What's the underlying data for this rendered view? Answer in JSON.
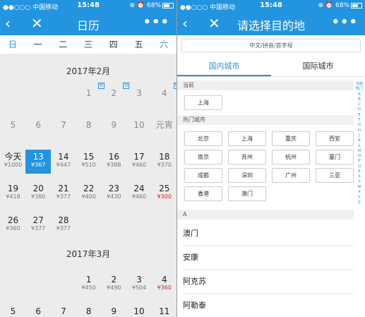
{
  "status": {
    "carrier": "●●○○○ 中国移动",
    "time": "15:48",
    "battery": "⊕ ⏰ 68%"
  },
  "calendar": {
    "title": "日历",
    "weekdays": [
      "日",
      "一",
      "二",
      "三",
      "四",
      "五",
      "六"
    ],
    "feb_title": "2017年2月",
    "mar_title": "2017年3月",
    "feb_rows": [
      [
        {
          "d": ""
        },
        {
          "d": ""
        },
        {
          "d": ""
        },
        {
          "d": "1",
          "past": true,
          "ban": "班"
        },
        {
          "d": "2",
          "past": true,
          "ban": "班"
        },
        {
          "d": "3",
          "past": true
        },
        {
          "d": "4",
          "past": true,
          "ban": "班"
        }
      ],
      [
        {
          "d": "5",
          "past": true
        },
        {
          "d": "6",
          "past": true
        },
        {
          "d": "7",
          "past": true
        },
        {
          "d": "8",
          "past": true
        },
        {
          "d": "9",
          "past": true
        },
        {
          "d": "10",
          "past": true
        },
        {
          "d": "元宵",
          "past": true
        }
      ],
      [
        {
          "d": "今天",
          "p": "¥1000"
        },
        {
          "d": "13",
          "p": "¥367",
          "sel": true
        },
        {
          "d": "14",
          "p": "¥447"
        },
        {
          "d": "15",
          "p": "¥510"
        },
        {
          "d": "16",
          "p": "¥388"
        },
        {
          "d": "17",
          "p": "¥460"
        },
        {
          "d": "18",
          "p": "¥370"
        }
      ],
      [
        {
          "d": "19",
          "p": "¥418"
        },
        {
          "d": "20",
          "p": "¥380"
        },
        {
          "d": "21",
          "p": "¥377"
        },
        {
          "d": "22",
          "p": "¥400"
        },
        {
          "d": "23",
          "p": "¥430"
        },
        {
          "d": "24",
          "p": "¥460"
        },
        {
          "d": "25",
          "p": "¥300",
          "red": true
        }
      ],
      [
        {
          "d": "26",
          "p": "¥360"
        },
        {
          "d": "27",
          "p": "¥377"
        },
        {
          "d": "28",
          "p": "¥377"
        },
        {
          "d": ""
        },
        {
          "d": ""
        },
        {
          "d": ""
        },
        {
          "d": ""
        }
      ]
    ],
    "mar_rows": [
      [
        {
          "d": ""
        },
        {
          "d": ""
        },
        {
          "d": ""
        },
        {
          "d": "1",
          "p": "¥450"
        },
        {
          "d": "2",
          "p": "¥490"
        },
        {
          "d": "3",
          "p": "¥504"
        },
        {
          "d": "4",
          "p": "¥360",
          "red": true
        }
      ],
      [
        {
          "d": "5"
        },
        {
          "d": "6"
        },
        {
          "d": "7"
        },
        {
          "d": "8"
        },
        {
          "d": "9"
        },
        {
          "d": "10"
        },
        {
          "d": "11"
        }
      ]
    ]
  },
  "dest": {
    "title": "请选择目的地",
    "search_placeholder": "中文/拼音/首字母",
    "tabs": [
      "国内城市",
      "国际城市"
    ],
    "current_label": "当前",
    "current_city": "上海",
    "hot_label": "热门城市",
    "hot_cities": [
      "北京",
      "上海",
      "重庆",
      "西安",
      "南京",
      "苏州",
      "杭州",
      "厦门",
      "成都",
      "深圳",
      "广州",
      "三亚",
      "香港",
      "澳门"
    ],
    "a_label": "A",
    "a_cities": [
      "澳门",
      "安康",
      "阿克苏",
      "阿勒泰"
    ],
    "index": [
      "当前",
      "热门",
      "A",
      "B",
      "C",
      "D",
      "E",
      "F",
      "G",
      "H",
      "J",
      "K",
      "L",
      "M",
      "N",
      "P",
      "Q",
      "R",
      "S",
      "T",
      "W",
      "X",
      "Y",
      "Z"
    ]
  }
}
